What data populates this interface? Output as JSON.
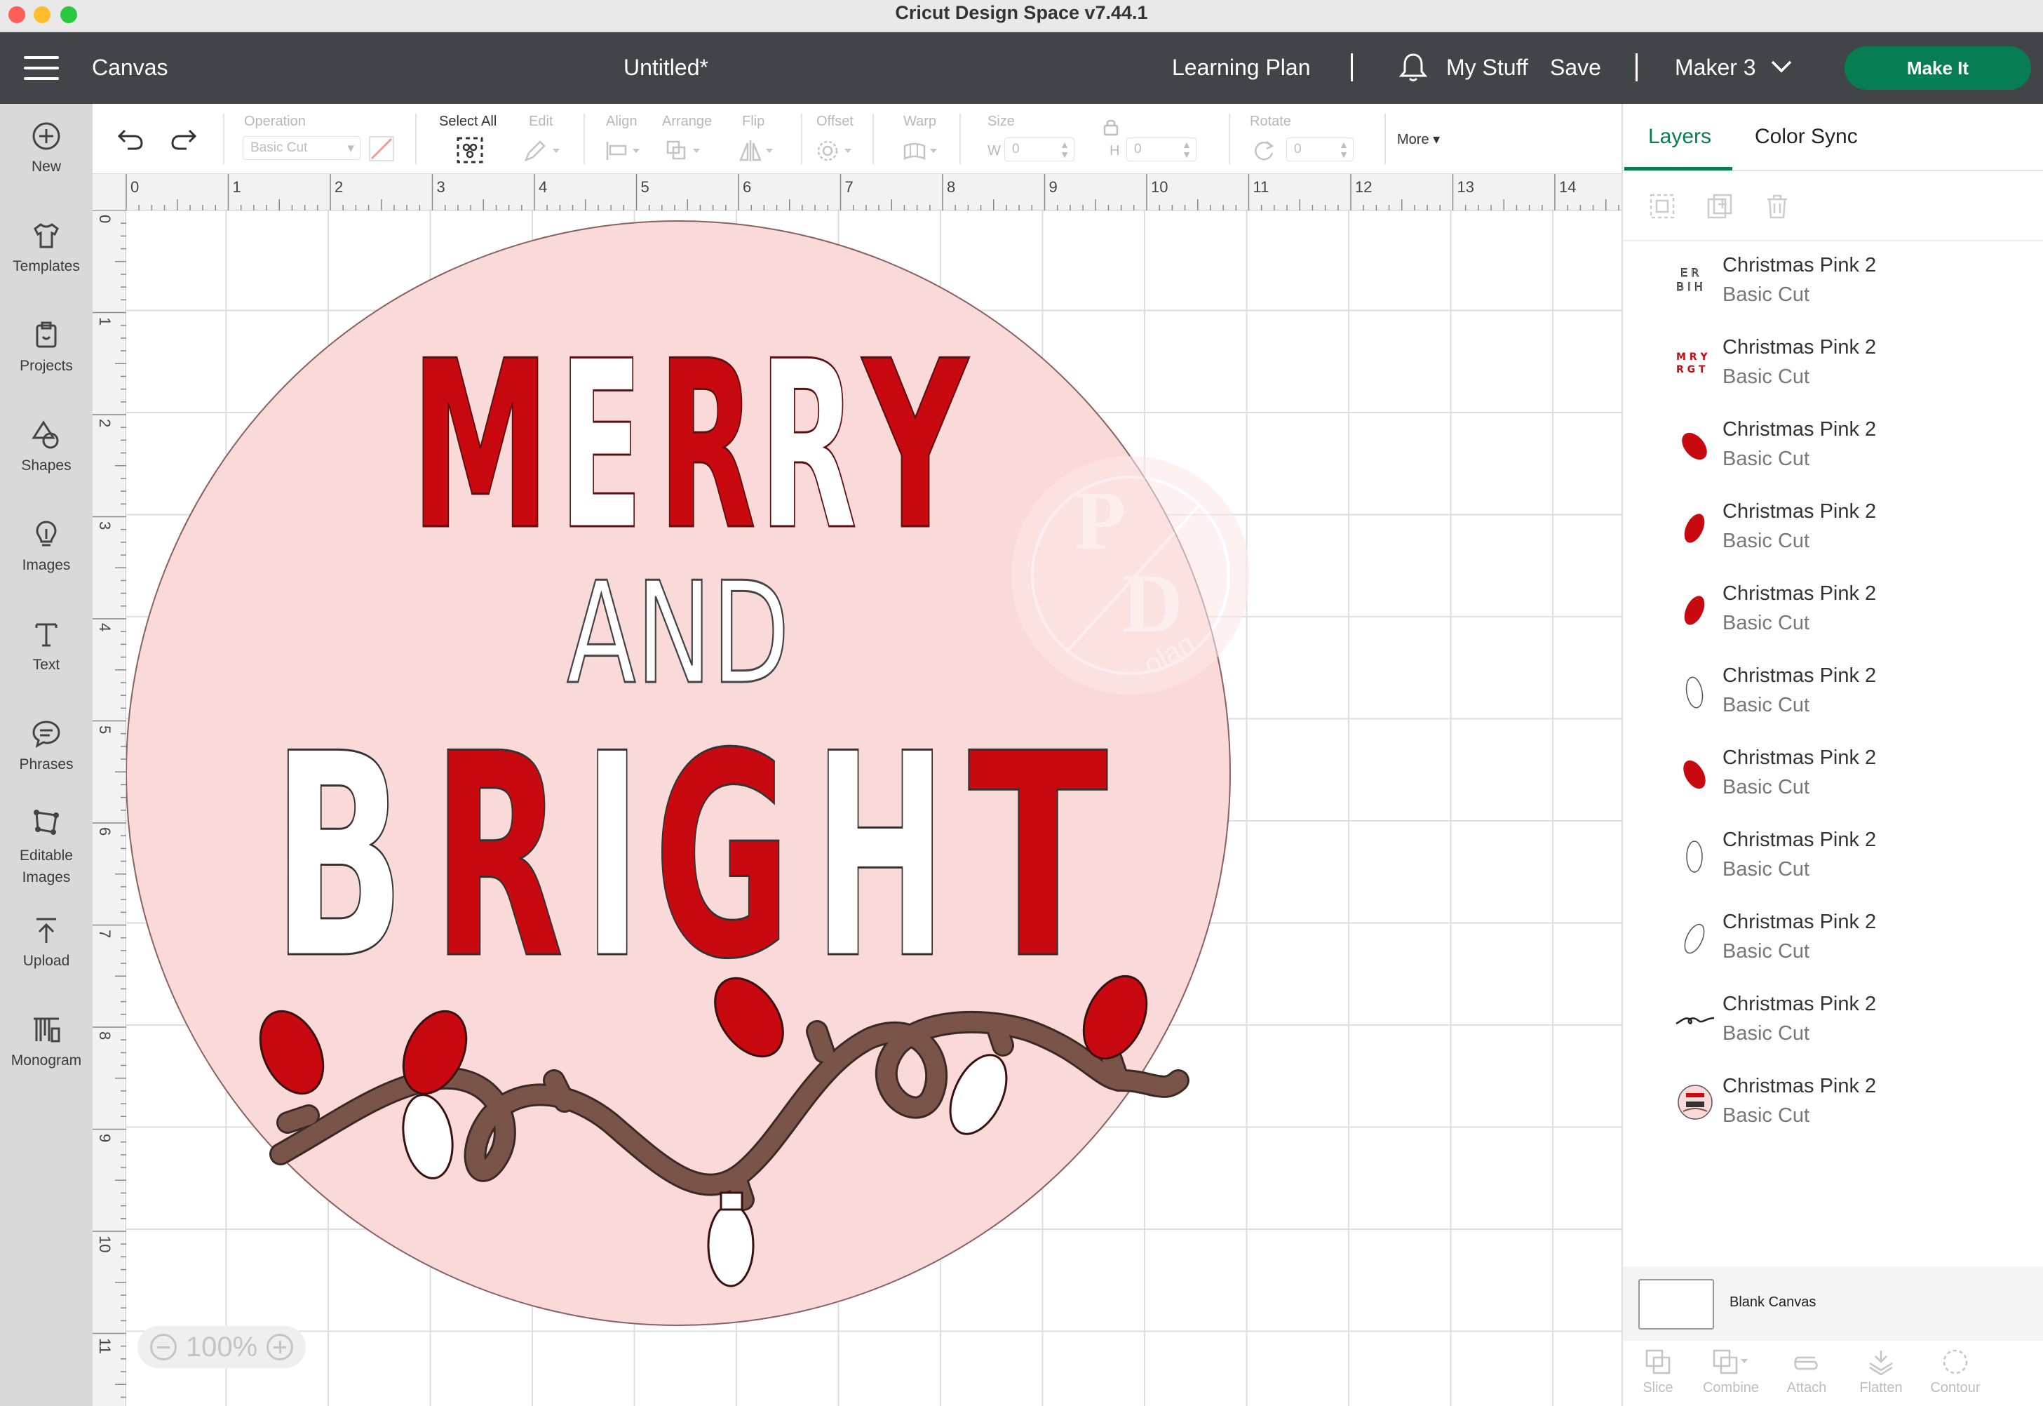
{
  "window": {
    "title": "Cricut Design Space  v7.44.1"
  },
  "header": {
    "canvas_label": "Canvas",
    "doc_title": "Untitled*",
    "learning_plan": "Learning Plan",
    "my_stuff": "My Stuff",
    "save": "Save",
    "machine": "Maker 3",
    "make_it": "Make It"
  },
  "sidebar": {
    "items": [
      {
        "label": "New",
        "icon": "plus-circle-icon"
      },
      {
        "label": "Templates",
        "icon": "tshirt-icon"
      },
      {
        "label": "Projects",
        "icon": "projects-icon"
      },
      {
        "label": "Shapes",
        "icon": "shapes-icon"
      },
      {
        "label": "Images",
        "icon": "lightbulb-icon"
      },
      {
        "label": "Text",
        "icon": "text-icon"
      },
      {
        "label": "Phrases",
        "icon": "speech-bubble-icon"
      },
      {
        "label": "Editable Images",
        "icon": "editable-images-icon"
      },
      {
        "label": "Upload",
        "icon": "upload-icon"
      },
      {
        "label": "Monogram",
        "icon": "monogram-icon"
      }
    ]
  },
  "toolbar": {
    "operation_label": "Operation",
    "operation_value": "Basic Cut",
    "select_all": "Select All",
    "edit": "Edit",
    "align": "Align",
    "arrange": "Arrange",
    "flip": "Flip",
    "offset": "Offset",
    "warp": "Warp",
    "size": "Size",
    "w_label": "W",
    "w_value": "0",
    "h_label": "H",
    "h_value": "0",
    "rotate": "Rotate",
    "rotate_value": "0",
    "more": "More"
  },
  "rulers": {
    "top": [
      "0",
      "1",
      "2",
      "3",
      "4",
      "5",
      "6",
      "7",
      "8",
      "9",
      "10",
      "11",
      "12",
      "13",
      "14"
    ],
    "left": [
      "0",
      "1",
      "2",
      "3",
      "4",
      "5",
      "6",
      "7",
      "8",
      "9",
      "10",
      "11"
    ]
  },
  "design": {
    "line1": [
      "M",
      "E",
      "R",
      "R",
      "Y"
    ],
    "line2": "AND",
    "line3": [
      "B",
      "R",
      "I",
      "G",
      "H",
      "T"
    ],
    "watermark_top": "P",
    "watermark_bottom": "D",
    "watermark_text": "olan",
    "colors": {
      "pink": "#f9dad8",
      "red": "#c8090f",
      "white": "#ffffff",
      "cord": "#7a5448",
      "outline": "#5a1010"
    }
  },
  "zoom": {
    "value": "100%"
  },
  "panel": {
    "tabs": [
      "Layers",
      "Color Sync"
    ],
    "layers": [
      {
        "name": "Christmas Pink 2",
        "op": "Basic Cut",
        "thumb": "text-white-thumb"
      },
      {
        "name": "Christmas Pink 2",
        "op": "Basic Cut",
        "thumb": "text-red-thumb"
      },
      {
        "name": "Christmas Pink 2",
        "op": "Basic Cut",
        "thumb": "bulb-red-thumb"
      },
      {
        "name": "Christmas Pink 2",
        "op": "Basic Cut",
        "thumb": "bulb-red-thumb"
      },
      {
        "name": "Christmas Pink 2",
        "op": "Basic Cut",
        "thumb": "bulb-red-thumb"
      },
      {
        "name": "Christmas Pink 2",
        "op": "Basic Cut",
        "thumb": "bulb-white-thumb"
      },
      {
        "name": "Christmas Pink 2",
        "op": "Basic Cut",
        "thumb": "bulb-red-thumb"
      },
      {
        "name": "Christmas Pink 2",
        "op": "Basic Cut",
        "thumb": "bulb-white-thumb"
      },
      {
        "name": "Christmas Pink 2",
        "op": "Basic Cut",
        "thumb": "bulb-white-thumb"
      },
      {
        "name": "Christmas Pink 2",
        "op": "Basic Cut",
        "thumb": "cord-thumb"
      },
      {
        "name": "Christmas Pink 2",
        "op": "Basic Cut",
        "thumb": "circle-thumb"
      }
    ],
    "blank_canvas": "Blank Canvas",
    "bottom_actions": [
      "Slice",
      "Combine",
      "Attach",
      "Flatten",
      "Contour"
    ]
  }
}
